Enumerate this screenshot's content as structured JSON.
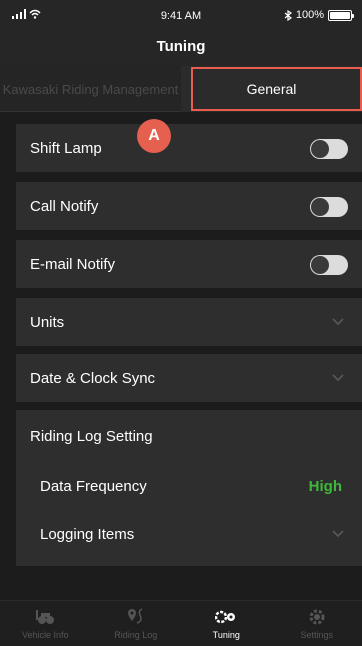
{
  "status_bar": {
    "time": "9:41 AM",
    "battery": "100%"
  },
  "header": {
    "title": "Tuning"
  },
  "tabs": [
    {
      "label": "Kawasaki Riding Management"
    },
    {
      "label": "General"
    }
  ],
  "marker": {
    "label": "A"
  },
  "settings": {
    "shift_lamp": "Shift Lamp",
    "call_notify": "Call Notify",
    "email_notify": "E-mail Notify",
    "units": "Units",
    "date_clock": "Date & Clock Sync",
    "riding_log": "Riding Log Setting",
    "data_frequency": "Data Frequency",
    "data_frequency_value": "High",
    "logging_items": "Logging Items"
  },
  "bottom_nav": [
    {
      "label": "Vehicle Info",
      "icon": "motorcycle-icon"
    },
    {
      "label": "Riding Log",
      "icon": "route-icon"
    },
    {
      "label": "Tuning",
      "icon": "tuning-icon"
    },
    {
      "label": "Settings",
      "icon": "gear-icon"
    }
  ],
  "colors": {
    "accent_green": "#3fb83a",
    "highlight": "#e85d4e"
  }
}
